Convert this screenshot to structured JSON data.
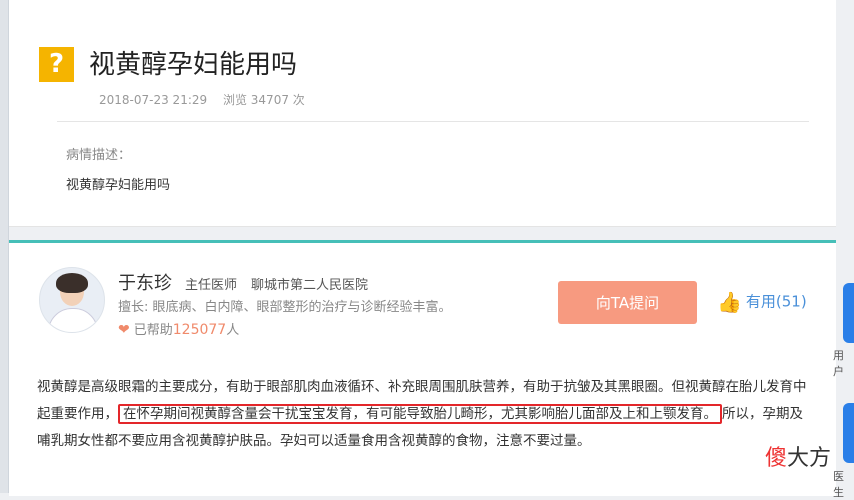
{
  "question": {
    "icon_glyph": "?",
    "title": "视黄醇孕妇能用吗",
    "date": "2018-07-23 21:29",
    "views": "浏览 34707 次",
    "desc_label": "病情描述：",
    "desc_text": "视黄醇孕妇能用吗"
  },
  "doctor": {
    "name": "于东珍",
    "title": "主任医师",
    "hospital": "聊城市第二人民医院",
    "specialty": "擅长: 眼底病、白内障、眼部整形的治疗与诊断经验丰富。",
    "helped_prefix": "已帮助",
    "helped_count": "125077",
    "helped_suffix": "人",
    "ask_label": "向TA提问",
    "useful_label": "有用(51)"
  },
  "answer": {
    "part1": "视黄醇是高级眼霜的主要成分，有助于眼部肌肉血液循环、补充眼周围肌肤营养，有助于抗皱及其黑眼圈。但视黄醇在胎儿发育中起重要作用，",
    "highlight": "在怀孕期间视黄醇含量会干扰宝宝发育，有可能导致胎儿畸形，尤其影响胎儿面部及上和上颚发育。",
    "part2": "所以，孕期及哺乳期女性都不要应用含视黄醇护肤品。孕妇可以适量食用含视黄醇的食物，注意不要过量。"
  },
  "side": {
    "label1": "用户",
    "label2": "医生"
  },
  "watermark": {
    "red": "傻",
    "rest": "大方"
  },
  "colors": {
    "accent_teal": "#46bfb8",
    "ask_button": "#f79a80",
    "question_icon": "#f5b400",
    "highlight_border": "#e3262a"
  }
}
